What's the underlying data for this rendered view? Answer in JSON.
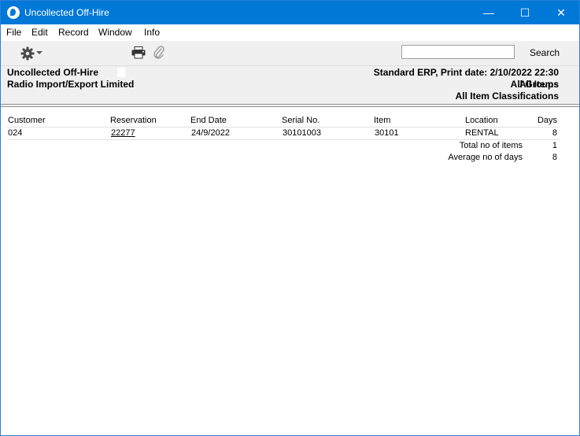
{
  "window": {
    "title": "Uncollected Off-Hire",
    "minimize_glyph": "—",
    "maximize_glyph": "☐",
    "close_glyph": "✕"
  },
  "menu": [
    "File",
    "Edit",
    "Record",
    "Window",
    "Info"
  ],
  "toolbar": {
    "search_label": "Search",
    "search_value": "",
    "icons": [
      "gear-icon",
      "printer-icon",
      "paperclip-icon"
    ]
  },
  "report": {
    "title": "Uncollected Off-Hire",
    "company": "Radio Import/Export Limited",
    "print_info": "Standard ERP, Print date: 2/10/2022 22:30",
    "filter_1": "All Items",
    "filter_2": "All Groups",
    "filter_3": "All Item Classifications"
  },
  "table": {
    "headers": {
      "customer": "Customer",
      "reservation": "Reservation",
      "end_date": "End Date",
      "serial": "Serial No.",
      "item": "Item",
      "location": "Location",
      "days": "Days"
    },
    "rows": [
      {
        "customer": "024",
        "reservation": "22277",
        "end_date": "24/9/2022",
        "serial": "30101003",
        "item": "30101",
        "location": "RENTAL",
        "days": "8"
      }
    ]
  },
  "totals": {
    "total_items_label": "Total no of items",
    "total_items_value": "1",
    "avg_days_label": "Average no of days",
    "avg_days_value": "8"
  }
}
